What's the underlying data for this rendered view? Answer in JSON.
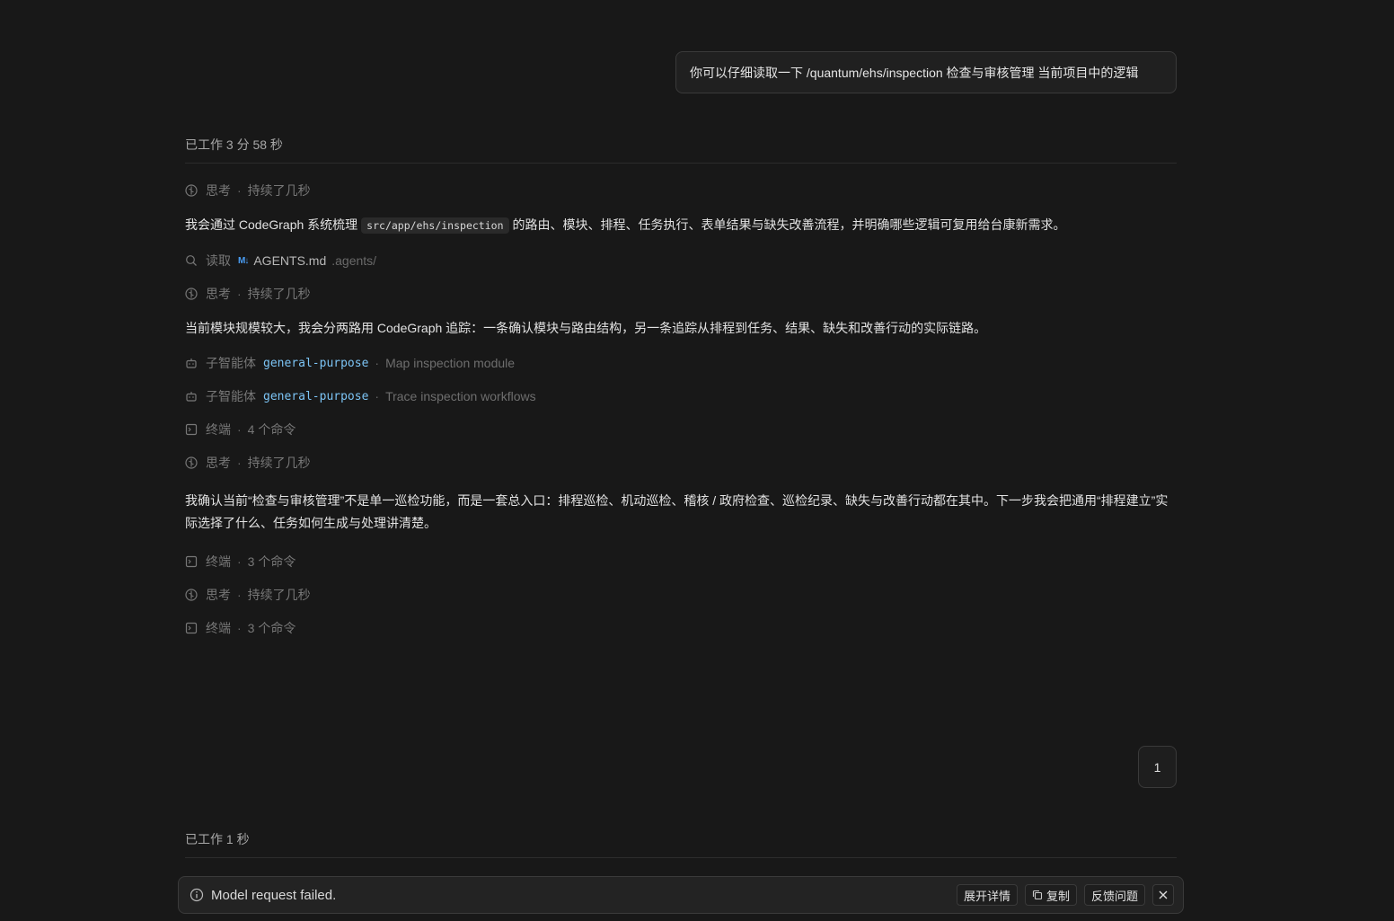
{
  "user_message": "你可以仔细读取一下  /quantum/ehs/inspection 检查与审核管理 当前项目中的逻辑",
  "turn1": {
    "worked_label": "已工作 3 分 58 秒",
    "steps": [
      {
        "kind": "thinking",
        "label": "思考",
        "detail": "持续了几秒"
      },
      {
        "kind": "para",
        "before": "我会通过 CodeGraph 系统梳理",
        "code": "src/app/ehs/inspection",
        "after": "的路由、模块、排程、任务执行、表单结果与缺失改善流程，并明确哪些逻辑可复用给台康新需求。"
      },
      {
        "kind": "read",
        "label": "读取",
        "file_icon": "M↓",
        "file": "AGENTS.md",
        "dir": ".agents/"
      },
      {
        "kind": "thinking",
        "label": "思考",
        "detail": "持续了几秒"
      },
      {
        "kind": "para",
        "text": "当前模块规模较大，我会分两路用 CodeGraph 追踪：一条确认模块与路由结构，另一条追踪从排程到任务、结果、缺失和改善行动的实际链路。"
      },
      {
        "kind": "agent",
        "label": "子智能体",
        "agent": "general-purpose",
        "task": "Map inspection module"
      },
      {
        "kind": "agent",
        "label": "子智能体",
        "agent": "general-purpose",
        "task": "Trace inspection workflows"
      },
      {
        "kind": "terminal",
        "label": "终端",
        "detail": "4 个命令"
      },
      {
        "kind": "thinking",
        "label": "思考",
        "detail": "持续了几秒"
      },
      {
        "kind": "para",
        "text": "我确认当前“检查与审核管理”不是单一巡检功能，而是一套总入口：排程巡检、机动巡检、稽核 / 政府检查、巡检纪录、缺失与改善行动都在其中。下一步我会把通用“排程建立”实际选择了什么、任务如何生成与处理讲清楚。"
      },
      {
        "kind": "terminal",
        "label": "终端",
        "detail": "3 个命令"
      },
      {
        "kind": "thinking",
        "label": "思考",
        "detail": "持续了几秒"
      },
      {
        "kind": "terminal",
        "label": "终端",
        "detail": "3 个命令"
      }
    ]
  },
  "page_button": "1",
  "turn2": {
    "worked_label": "已工作 1 秒"
  },
  "error": {
    "message": "Model request failed.",
    "expand_label": "展开详情",
    "copy_label": "复制",
    "feedback_label": "反馈问题"
  }
}
